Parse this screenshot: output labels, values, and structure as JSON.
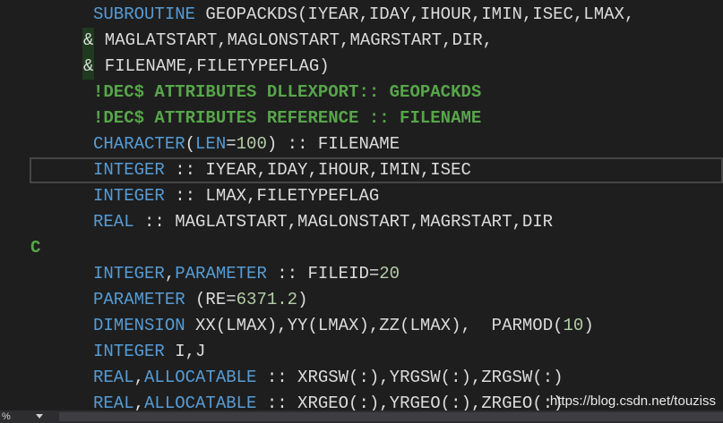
{
  "editor": {
    "lines": [
      [
        {
          "c": "kw",
          "t": "SUBROUTINE"
        },
        {
          "c": "id",
          "t": " GEOPACKDS(IYEAR,IDAY,IHOUR,IMIN,ISEC,LMAX,"
        }
      ],
      [
        {
          "c": "amp",
          "t": "&"
        },
        {
          "c": "id",
          "t": " MAGLATSTART,MAGLONSTART,MAGRSTART,DIR,"
        }
      ],
      [
        {
          "c": "amp",
          "t": "&"
        },
        {
          "c": "id",
          "t": " FILENAME,FILETYPEFLAG)"
        }
      ],
      [
        {
          "c": "cm",
          "t": "!DEC$ ATTRIBUTES DLLEXPORT:: GEOPACKDS"
        }
      ],
      [
        {
          "c": "cm",
          "t": "!DEC$ ATTRIBUTES REFERENCE :: FILENAME"
        }
      ],
      [
        {
          "c": "kw",
          "t": "CHARACTER"
        },
        {
          "c": "id",
          "t": "("
        },
        {
          "c": "kw",
          "t": "LEN"
        },
        {
          "c": "id",
          "t": "="
        },
        {
          "c": "num",
          "t": "100"
        },
        {
          "c": "id",
          "t": ") :: FILENAME"
        }
      ],
      [
        {
          "c": "kw",
          "t": "INTEGER"
        },
        {
          "c": "id",
          "t": " :: IYEAR,IDAY,IHOUR,IMIN,ISEC"
        }
      ],
      [
        {
          "c": "kw",
          "t": "INTEGER"
        },
        {
          "c": "id",
          "t": " :: LMAX,FILETYPEFLAG"
        }
      ],
      [
        {
          "c": "kw",
          "t": "REAL"
        },
        {
          "c": "id",
          "t": " :: MAGLATSTART,MAGLONSTART,MAGRSTART,DIR"
        }
      ],
      [
        {
          "c": "cm",
          "t": "C"
        }
      ],
      [
        {
          "c": "kw",
          "t": "INTEGER"
        },
        {
          "c": "id",
          "t": ","
        },
        {
          "c": "kw",
          "t": "PARAMETER"
        },
        {
          "c": "id",
          "t": " :: FILEID="
        },
        {
          "c": "num",
          "t": "20"
        }
      ],
      [
        {
          "c": "kw",
          "t": "PARAMETER"
        },
        {
          "c": "id",
          "t": " (RE="
        },
        {
          "c": "num",
          "t": "6371.2"
        },
        {
          "c": "id",
          "t": ")"
        }
      ],
      [
        {
          "c": "kw",
          "t": "DIMENSION"
        },
        {
          "c": "id",
          "t": " XX(LMAX),YY(LMAX),ZZ(LMAX),  PARMOD("
        },
        {
          "c": "num",
          "t": "10"
        },
        {
          "c": "id",
          "t": ")"
        }
      ],
      [
        {
          "c": "kw",
          "t": "INTEGER"
        },
        {
          "c": "id",
          "t": " I,J"
        }
      ],
      [
        {
          "c": "kw",
          "t": "REAL"
        },
        {
          "c": "id",
          "t": ","
        },
        {
          "c": "kw",
          "t": "ALLOCATABLE"
        },
        {
          "c": "id",
          "t": " :: XRGSW(:),YRGSW(:),ZRGSW(:)"
        }
      ],
      [
        {
          "c": "kw",
          "t": "REAL"
        },
        {
          "c": "id",
          "t": ","
        },
        {
          "c": "kw",
          "t": "ALLOCATABLE"
        },
        {
          "c": "id",
          "t": " :: XRGEO(:),YRGEO(:),ZRGEO(:)"
        }
      ]
    ],
    "current_line_index": 6
  },
  "statusbar": {
    "zoom": "%"
  },
  "watermark": "https://blog.csdn.net/touziss",
  "colors": {
    "background": "#1e1e1e",
    "keyword": "#569cd6",
    "comment": "#57a64a",
    "number": "#b5cea8",
    "identifier": "#dcdcdc"
  }
}
